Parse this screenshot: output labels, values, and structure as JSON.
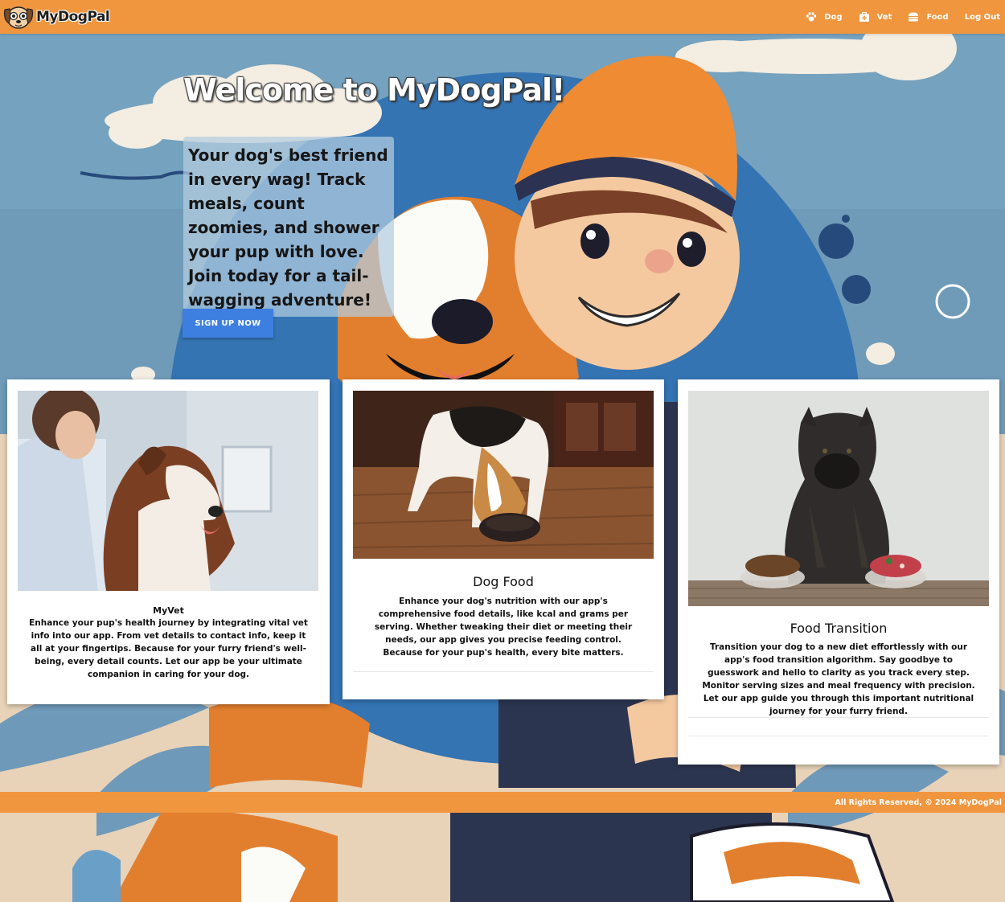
{
  "brand": {
    "name": "MyDogPal",
    "logo_icon": "dog-face-logo"
  },
  "nav": {
    "items": [
      {
        "label": "Dog",
        "icon": "paw-icon"
      },
      {
        "label": "Vet",
        "icon": "medical-kit-icon"
      },
      {
        "label": "Food",
        "icon": "hamburger-icon"
      }
    ],
    "logout_label": "Log Out"
  },
  "hero": {
    "title": "Welcome to MyDogPal!",
    "tagline": "Your dog's best friend in every wag! Track meals, count zoomies, and shower your pup with love. Join today for a tail-wagging adventure!",
    "cta_label": "Sign Up Now"
  },
  "cards": [
    {
      "title": "MyVet",
      "image": "woman-with-border-collie-photo",
      "text": "Enhance your pup's health journey by integrating vital vet info into our app. From vet details to contact info, keep it all at your fingertips. Because for your furry friend's well-being, every detail counts. Let our app be your ultimate companion in caring for your dog."
    },
    {
      "title": "Dog Food",
      "image": "beagle-eating-from-bowl-photo",
      "text": "Enhance your dog's nutrition with our app's comprehensive food details, like kcal and grams per serving. Whether tweaking their diet or meeting their needs, our app gives you precise feeding control. Because for your pup's health, every bite matters."
    },
    {
      "title": "Food Transition",
      "image": "cane-corso-with-kibble-and-raw-food-photo",
      "text": "Transition your dog to a new diet effortlessly with our app's food transition algorithm. Say goodbye to guesswork and hello to clarity as you track every step. Monitor serving sizes and meal frequency with precision. Let our app guide you through this important nutritional journey for your furry friend."
    }
  ],
  "footer": {
    "text": "All Rights Reserved, © 2024 MyDogPal"
  },
  "colors": {
    "nav_bg": "#f0963f",
    "cta_bg": "#3d7fe0",
    "sky": "#6f9bb8"
  }
}
